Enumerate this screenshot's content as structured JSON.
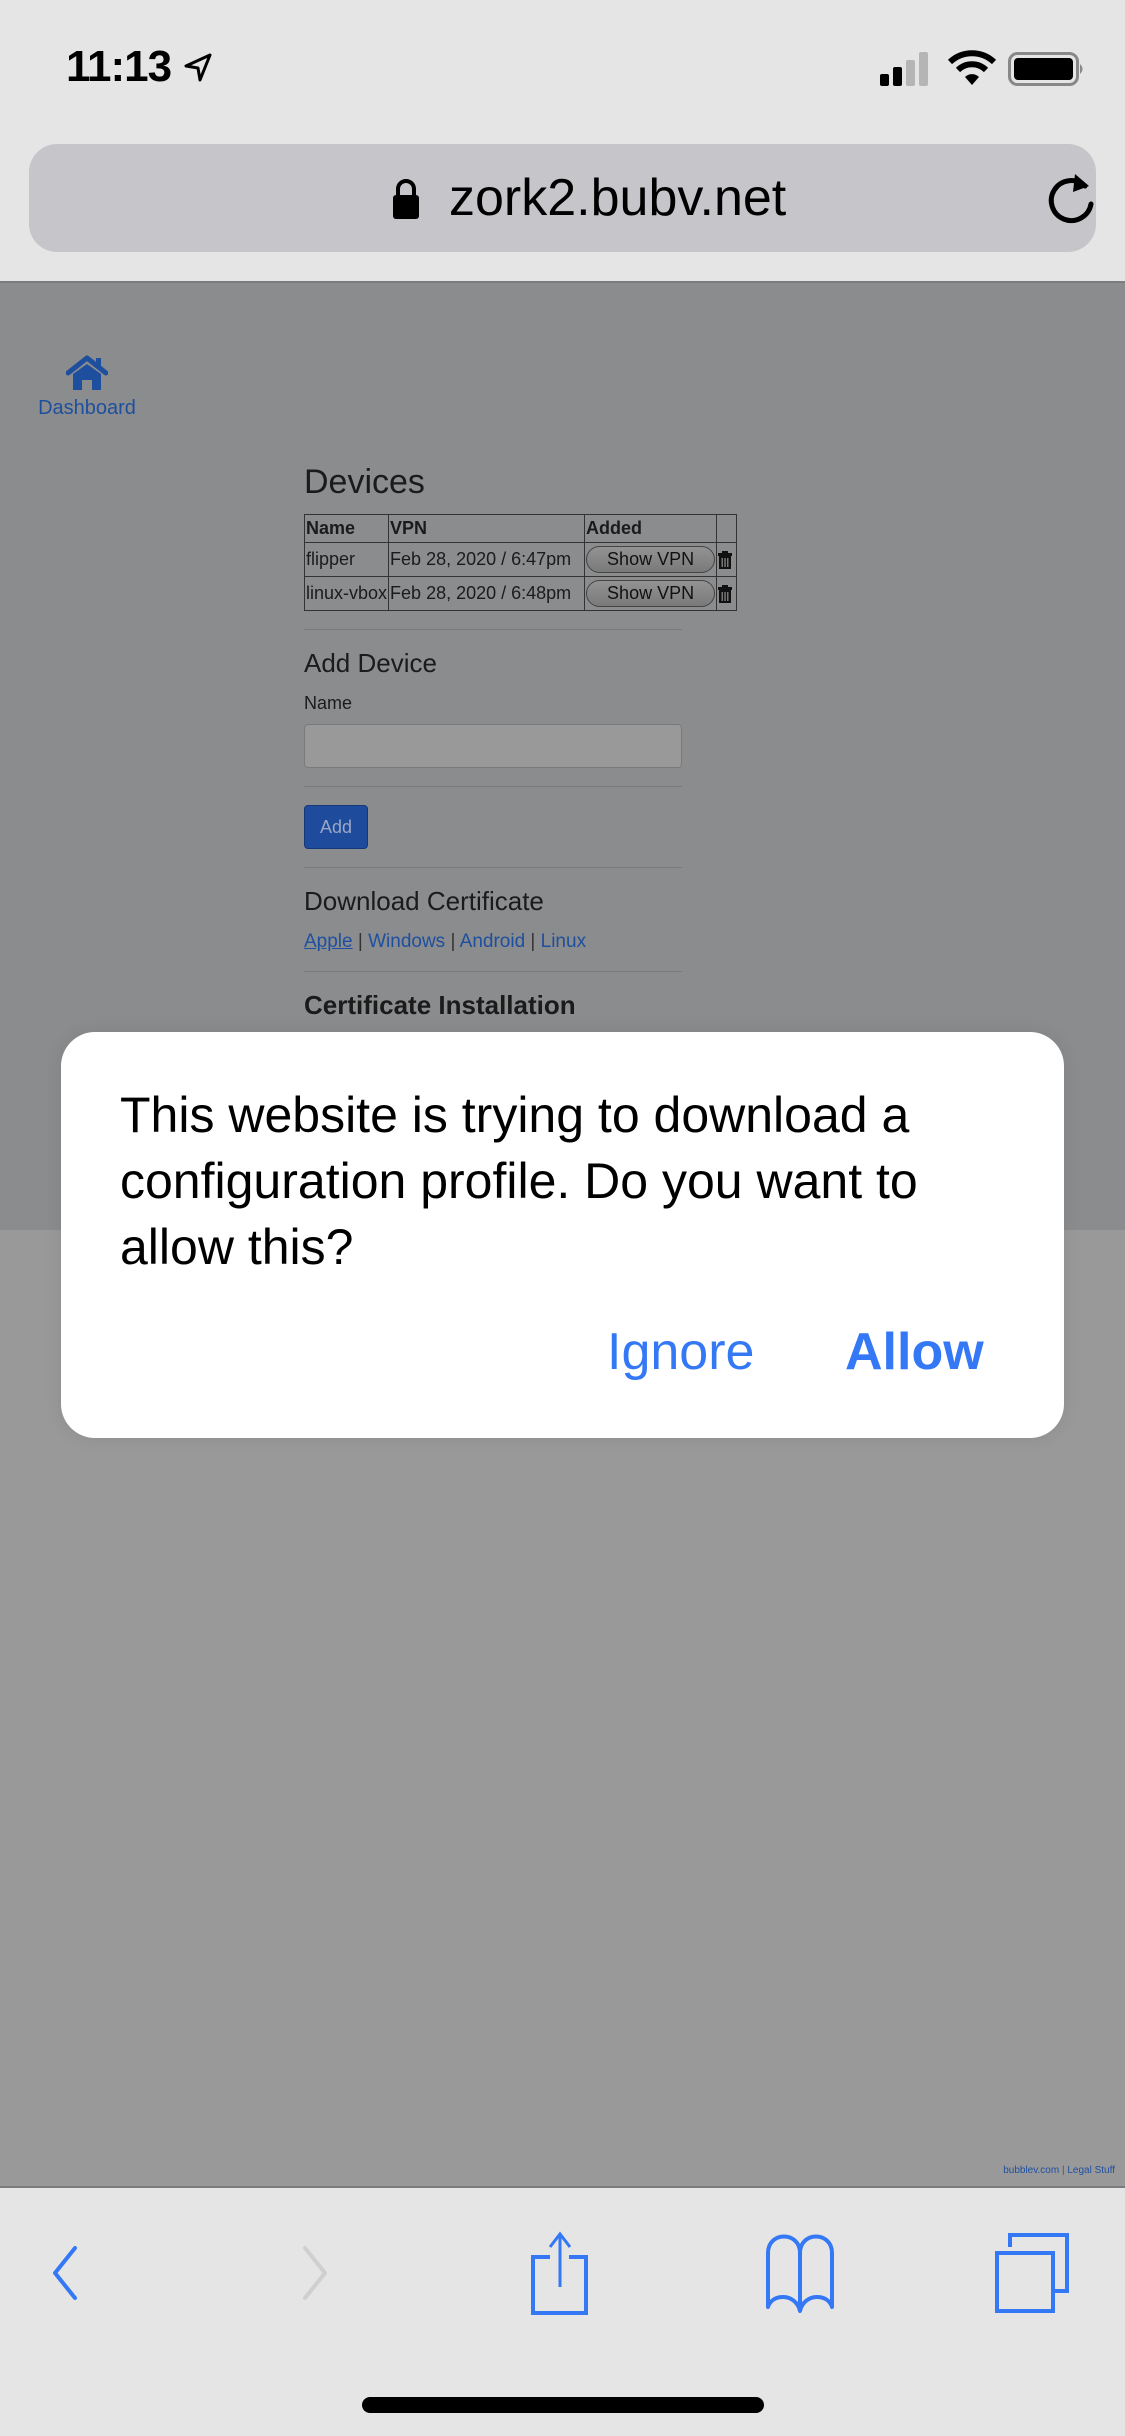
{
  "status_bar": {
    "time": "11:13",
    "icons": [
      "location-arrow-icon",
      "cellular-signal-icon",
      "wifi-icon",
      "battery-icon"
    ]
  },
  "browser": {
    "url": "zork2.bubv.net",
    "secure_icon": "lock-icon",
    "reload_icon": "reload-icon"
  },
  "page": {
    "nav": {
      "icon": "home-icon",
      "label": "Dashboard"
    },
    "devices": {
      "title": "Devices",
      "columns": [
        "Name",
        "VPN",
        "Added",
        ""
      ],
      "rows": [
        {
          "name": "flipper",
          "added": "Feb 28, 2020 / 6:47pm",
          "action": "Show VPN"
        },
        {
          "name": "linux-vbox",
          "added": "Feb 28, 2020 / 6:48pm",
          "action": "Show VPN"
        }
      ]
    },
    "add_device": {
      "title": "Add Device",
      "name_label": "Name",
      "name_value": "",
      "add_button": "Add"
    },
    "download_certificate": {
      "title": "Download Certificate",
      "links": [
        "Apple",
        "Windows",
        "Android",
        "Linux"
      ],
      "separator": "|"
    },
    "certificate_installation": {
      "title": "Certificate Installation"
    },
    "footer": {
      "site": "bubblev.com",
      "separator": "|",
      "legal": "Legal Stuff"
    }
  },
  "alert": {
    "message": "This website is trying to download a configuration profile. Do you want to allow this?",
    "ignore_label": "Ignore",
    "allow_label": "Allow"
  },
  "toolbar": {
    "items": [
      "back-icon",
      "forward-icon",
      "share-icon",
      "bookmarks-icon",
      "tabs-icon"
    ],
    "forward_enabled": false
  },
  "colors": {
    "accent": "#3478f6",
    "link": "#1e4f9f",
    "overlay": "#8b8c8e"
  }
}
